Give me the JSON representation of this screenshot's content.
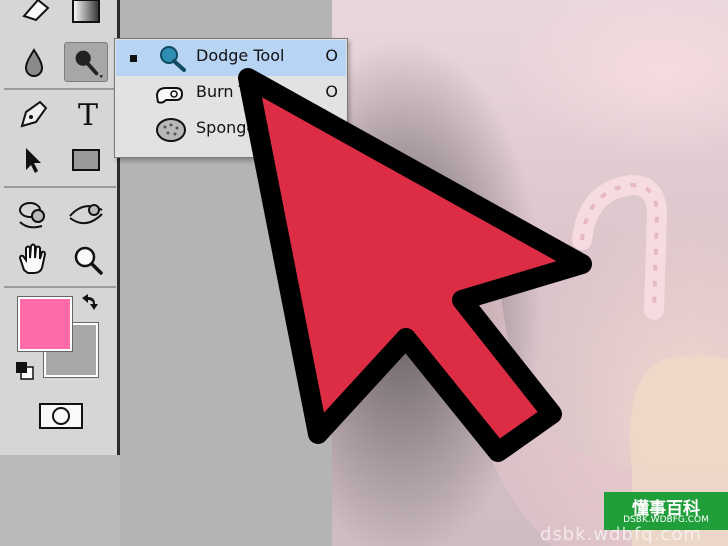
{
  "flyout": {
    "items": [
      {
        "label": "Dodge Tool",
        "shortcut": "O",
        "icon": "dodge-icon",
        "selected": true
      },
      {
        "label": "Burn T",
        "shortcut": "O",
        "icon": "burn-icon",
        "selected": false
      },
      {
        "label": "Sponge",
        "shortcut": "",
        "icon": "sponge-icon",
        "selected": false
      }
    ]
  },
  "toolbar": {
    "type_tool_glyph": "T",
    "foreground_color": "#ff6aa8",
    "background_color": "#a8a8a8"
  },
  "cursor": {
    "color": "#dc2d45",
    "outline": "#000000"
  },
  "watermark": {
    "badge_text": "懂事百科",
    "badge_sub": "DSBK.WDBFG.COM",
    "url_text": "dsbk.wdbfq.com"
  }
}
